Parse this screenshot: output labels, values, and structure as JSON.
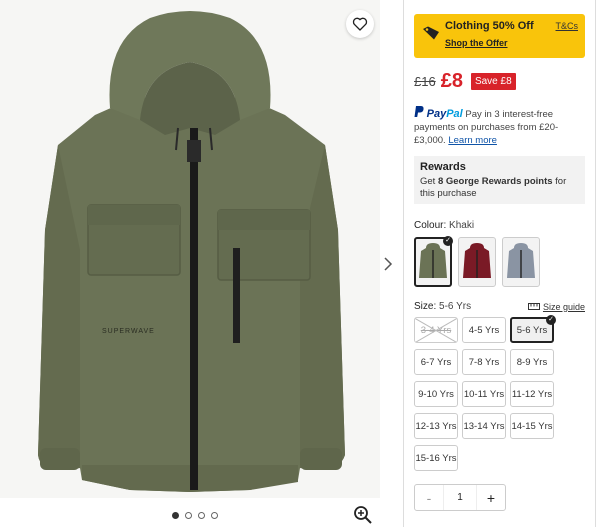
{
  "gallery": {
    "favourite_icon": "heart-icon",
    "next_icon": "chevron-right-icon",
    "zoom_icon": "zoom-in-icon",
    "dot_count": 4,
    "active_dot": 0,
    "jacket_color": "#6b7356",
    "chest_print": "SUPERWAVE"
  },
  "promo": {
    "title": "Clothing 50% Off",
    "link": "Shop the Offer",
    "tc": "T&Cs",
    "icon": "price-tag-icon",
    "color": "#f9c40b"
  },
  "price": {
    "old": "£16",
    "new": "£8",
    "save": "Save £8",
    "accent": "#d8232a"
  },
  "paypal": {
    "logo_part1": "Pay",
    "logo_part2": "Pal",
    "text": "Pay in 3 interest-free payments on purchases from £20-£3,000.",
    "link": "Learn more",
    "icon": "paypal-icon"
  },
  "rewards": {
    "title": "Rewards",
    "text_prefix": "Get ",
    "points": "8 George Rewards points",
    "text_suffix": " for this purchase"
  },
  "colour": {
    "label": "Colour:",
    "value": "Khaki",
    "swatches": [
      {
        "name": "Khaki",
        "color": "#6b7356",
        "selected": true
      },
      {
        "name": "Burgundy",
        "color": "#7a1a26",
        "selected": false
      },
      {
        "name": "Grey",
        "color": "#8a94a3",
        "selected": false
      }
    ]
  },
  "size": {
    "label": "Size:",
    "value": "5-6 Yrs",
    "guide": "Size guide",
    "guide_icon": "ruler-icon",
    "options": [
      {
        "label": "3-4 Yrs",
        "state": "unavailable"
      },
      {
        "label": "4-5 Yrs",
        "state": "available"
      },
      {
        "label": "5-6 Yrs",
        "state": "selected"
      },
      {
        "label": "6-7 Yrs",
        "state": "available"
      },
      {
        "label": "7-8 Yrs",
        "state": "available"
      },
      {
        "label": "8-9 Yrs",
        "state": "available"
      },
      {
        "label": "9-10 Yrs",
        "state": "available"
      },
      {
        "label": "10-11 Yrs",
        "state": "available"
      },
      {
        "label": "11-12 Yrs",
        "state": "available"
      },
      {
        "label": "12-13 Yrs",
        "state": "available"
      },
      {
        "label": "13-14 Yrs",
        "state": "available"
      },
      {
        "label": "14-15 Yrs",
        "state": "available"
      },
      {
        "label": "15-16 Yrs",
        "state": "available"
      }
    ]
  },
  "quantity": {
    "minus": "-",
    "value": "1",
    "plus": "+"
  }
}
